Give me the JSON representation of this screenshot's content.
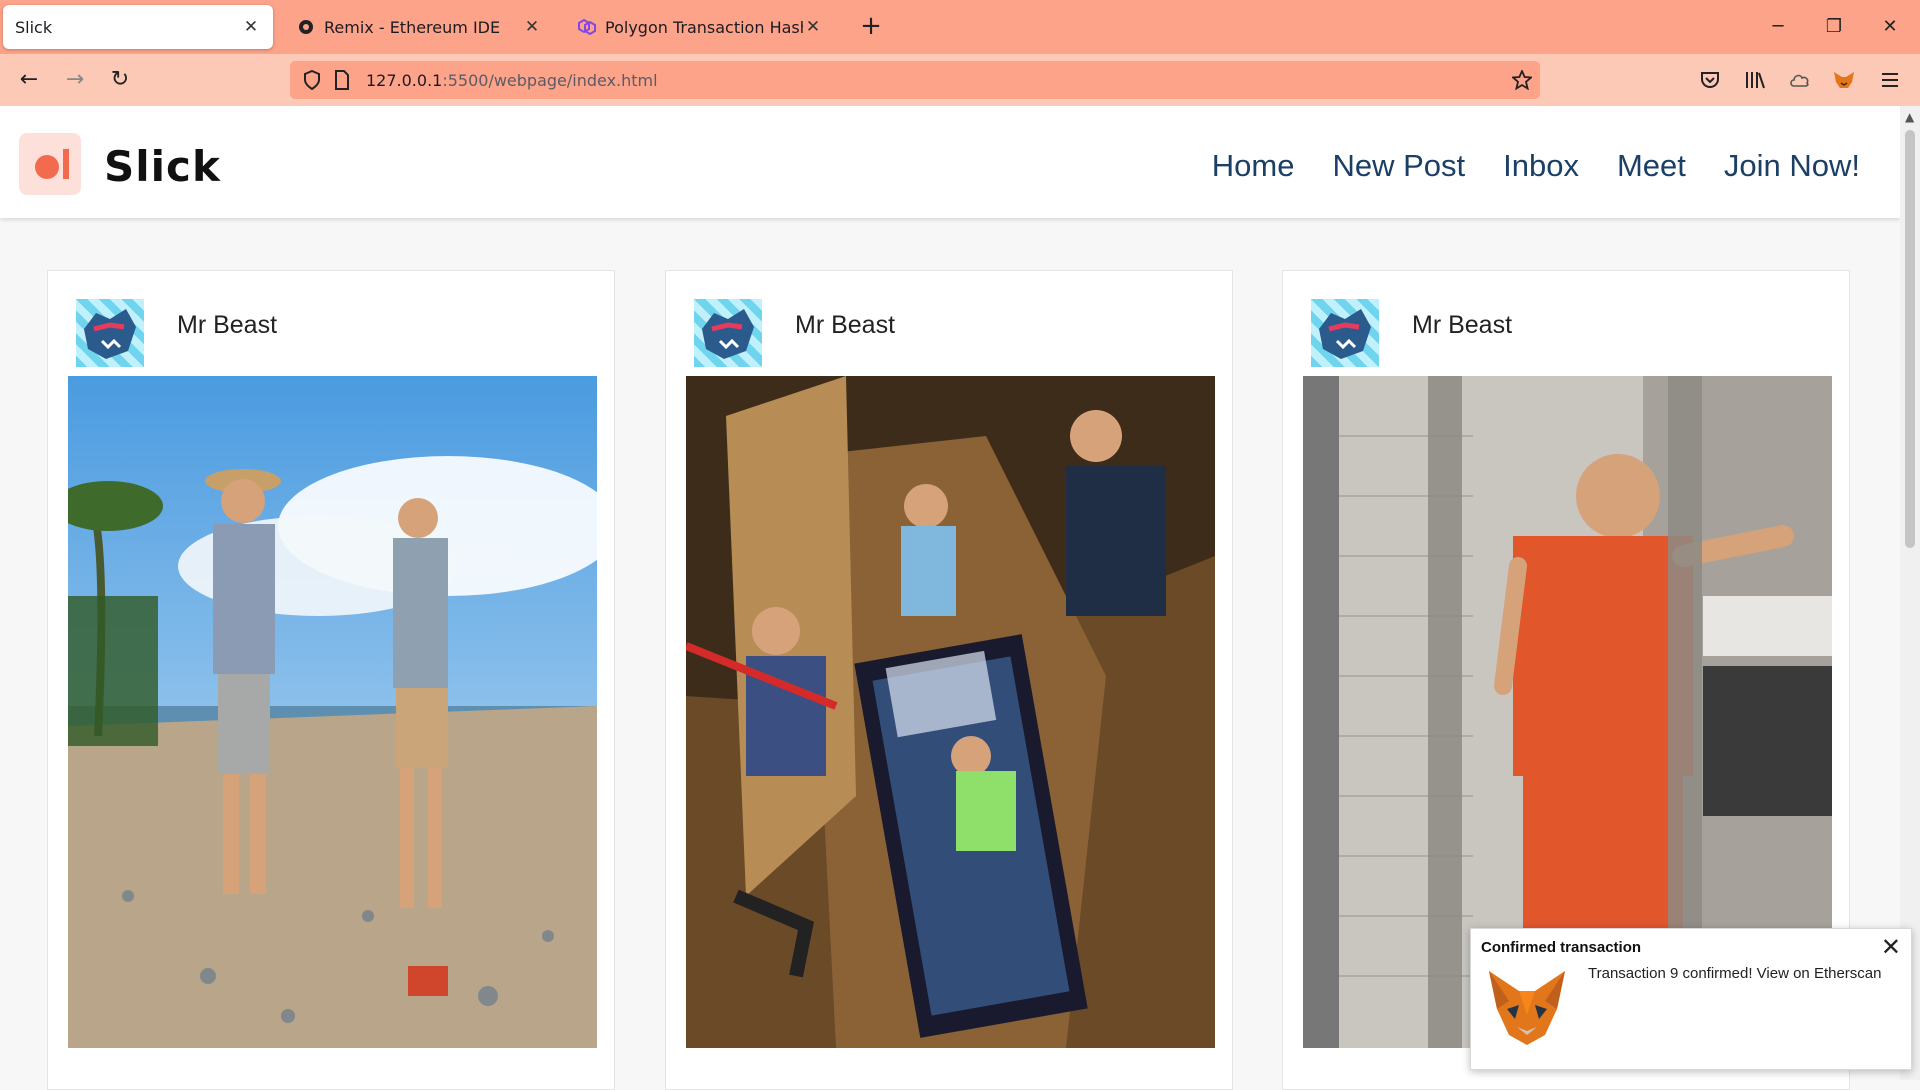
{
  "browser": {
    "tabs": [
      {
        "title": "Slick",
        "active": true
      },
      {
        "title": "Remix - Ethereum IDE",
        "active": false
      },
      {
        "title": "Polygon Transaction Hash (Txha",
        "active": false
      }
    ],
    "url_host": "127.0.0.1",
    "url_path": ":5500/webpage/index.html",
    "colors": {
      "tabbar": "#fca389",
      "toolbar": "#fcc9b6"
    }
  },
  "site": {
    "title": "Slick",
    "nav": [
      "Home",
      "New Post",
      "Inbox",
      "Meet",
      "Join Now!"
    ],
    "accent": "#f36b4f",
    "nav_color": "#1c3f66"
  },
  "posts": [
    {
      "author": "Mr Beast",
      "image": "beach-cleanup-photo"
    },
    {
      "author": "Mr Beast",
      "image": "buried-in-coffin-photo"
    },
    {
      "author": "Mr Beast",
      "image": "jail-cell-photo"
    }
  ],
  "notification": {
    "title": "Confirmed transaction",
    "body": "Transaction 9 confirmed! View on Etherscan",
    "icon": "metamask-fox-icon"
  }
}
